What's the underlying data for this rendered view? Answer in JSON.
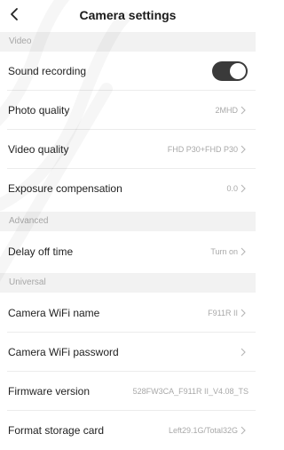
{
  "header": {
    "title": "Camera settings",
    "back_icon": "chevron-left-icon"
  },
  "sections": {
    "video": "Video",
    "advanced": "Advanced",
    "universal": "Universal"
  },
  "rows": {
    "sound_recording": {
      "label": "Sound recording",
      "toggle_on": true
    },
    "photo_quality": {
      "label": "Photo quality",
      "value": "2MHD"
    },
    "video_quality": {
      "label": "Video quality",
      "value": "FHD P30+FHD P30"
    },
    "exposure": {
      "label": "Exposure compensation",
      "value": "0.0"
    },
    "delay_off": {
      "label": "Delay off time",
      "value": "Turn on"
    },
    "wifi_name": {
      "label": "Camera WiFi name",
      "value": "F911R II"
    },
    "wifi_password": {
      "label": "Camera WiFi password",
      "value": ""
    },
    "firmware": {
      "label": "Firmware version",
      "value": "528FW3CA_F911R II_V4.08_TS"
    },
    "format_card": {
      "label": "Format storage card",
      "value": "Left29.1G/Total32G"
    }
  },
  "colors": {
    "toggle_on": "#3a3a3a",
    "section_bg": "#f2f2f2",
    "value_text": "#a8a8a8"
  }
}
